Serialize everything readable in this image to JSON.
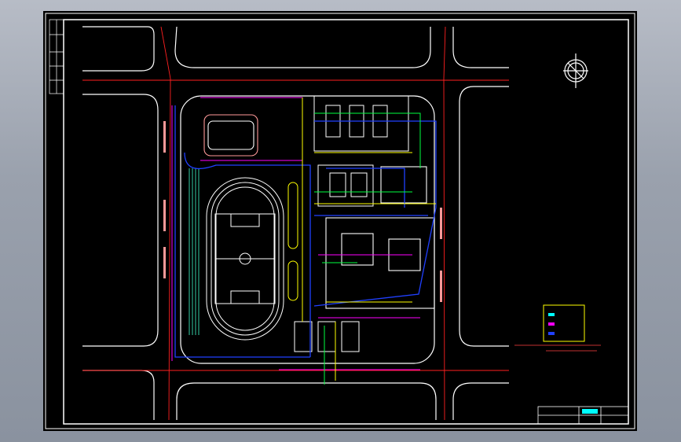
{
  "drawing": {
    "background": "#000000",
    "frame_color": "#ffffff",
    "road_color": "#ffffff",
    "red_line_color": "#ff2020",
    "pipe_colors": {
      "water": "#2040ff",
      "gas": "#ffff00",
      "power": "#ff00ff",
      "telecom": "#00ff40",
      "buildings": "#ff9999",
      "greenery": "#40ffcc"
    },
    "north_arrow": {
      "icon": "compass-north-icon"
    },
    "title_block": {
      "project_name": "",
      "drawing_title": "",
      "highlight_color": "#00ffff"
    },
    "legend": {
      "items": [
        {
          "swatch": "#00ffff",
          "label": ""
        },
        {
          "swatch": "#ff00ff",
          "label": ""
        },
        {
          "swatch": "#2040ff",
          "label": ""
        }
      ]
    }
  }
}
